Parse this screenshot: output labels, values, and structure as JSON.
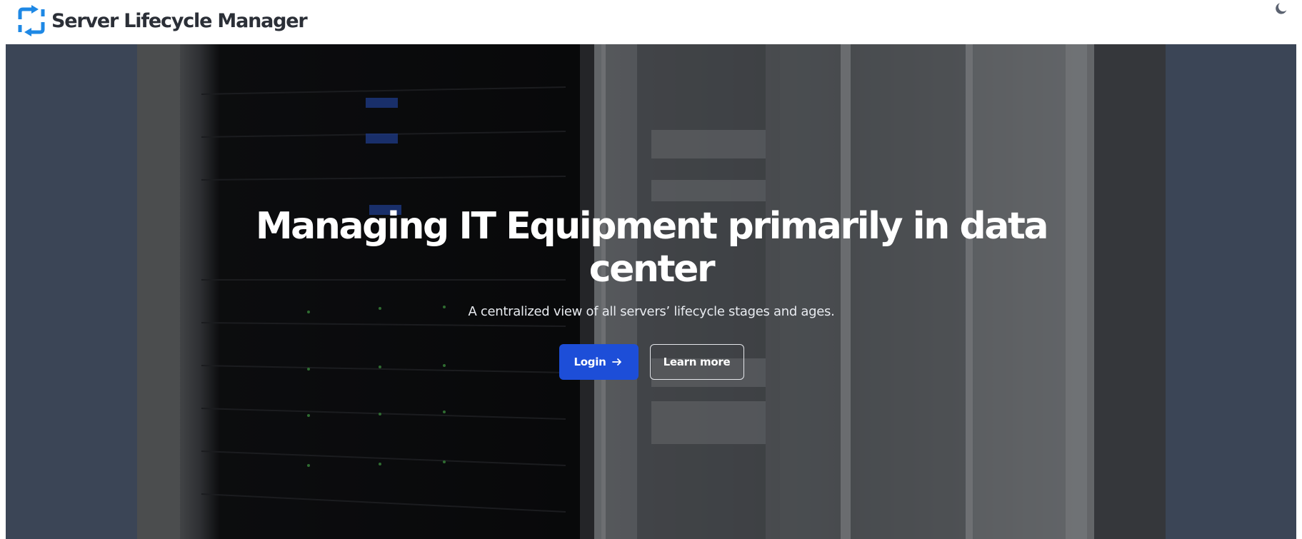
{
  "header": {
    "app_title": "Server Lifecycle Manager",
    "logo_icon": "sync-arrows-icon",
    "logo_color": "#1e88e5",
    "theme_toggle_icon": "moon-icon"
  },
  "hero": {
    "background_image": "server-racks-data-center-photo",
    "title": "Managing IT Equipment primarily in data center",
    "subtitle": "A centralized view of all servers’ lifecycle stages and ages.",
    "login_label": "Login",
    "login_icon": "arrow-right-icon",
    "learn_more_label": "Learn more",
    "accent_color": "#1d4ed8"
  }
}
